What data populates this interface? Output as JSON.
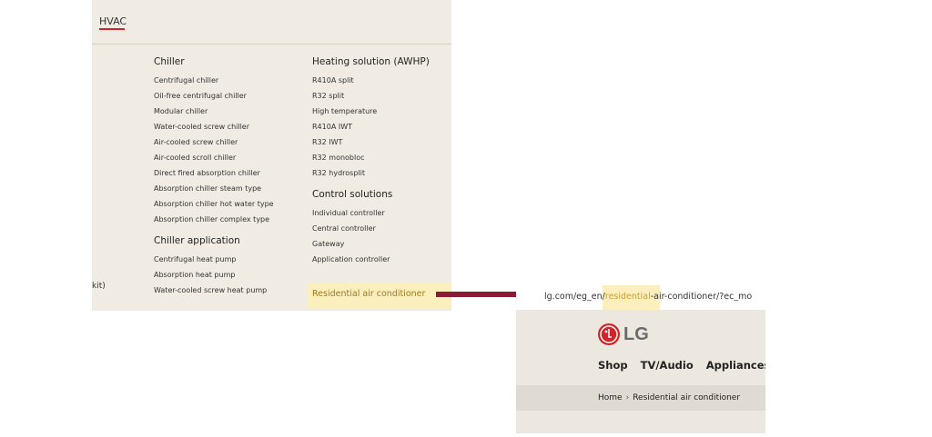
{
  "menu": {
    "tab_label": "HVAC",
    "cut_text": "kit)",
    "column_1": {
      "chiller": {
        "title": "Chiller",
        "items": [
          "Centrifugal chiller",
          "Oil-free centrifugal chiller",
          "Modular chiller",
          "Water-cooled screw chiller",
          "Air-cooled screw chiller",
          "Air-cooled scroll chiller",
          "Direct fired absorption chiller",
          "Absorption chiller steam type",
          "Absorption chiller hot water type",
          "Absorption chiller complex type"
        ]
      },
      "chiller_application": {
        "title": "Chiller application",
        "items": [
          "Centrifugal heat pump",
          "Absorption heat pump",
          "Water-cooled screw heat pump"
        ]
      }
    },
    "column_2": {
      "heating": {
        "title": "Heating solution (AWHP)",
        "items": [
          "R410A split",
          "R32 split",
          "High temperature",
          "R410A IWT",
          "R32 IWT",
          "R32 monobloc",
          "R32 hydrosplit"
        ]
      },
      "control": {
        "title": "Control solutions",
        "items": [
          "Individual controller",
          "Central controller",
          "Gateway",
          "Application controller"
        ]
      },
      "highlighted_item": "Residential air conditioner"
    }
  },
  "preview": {
    "url_prefix": "lg.com/eg_en/",
    "url_highlight": "residential",
    "url_suffix": "-air-conditioner/?ec_mo",
    "logo_text": "LG",
    "nav": [
      "Shop",
      "TV/Audio",
      "Appliances"
    ],
    "breadcrumb": {
      "home": "Home",
      "separator": "›",
      "current": "Residential air conditioner"
    }
  },
  "colors": {
    "brand_red": "#d0232a",
    "arrow": "#8e1b36",
    "highlight": "#fbefbe",
    "panel_bg": "#f0ece4"
  }
}
